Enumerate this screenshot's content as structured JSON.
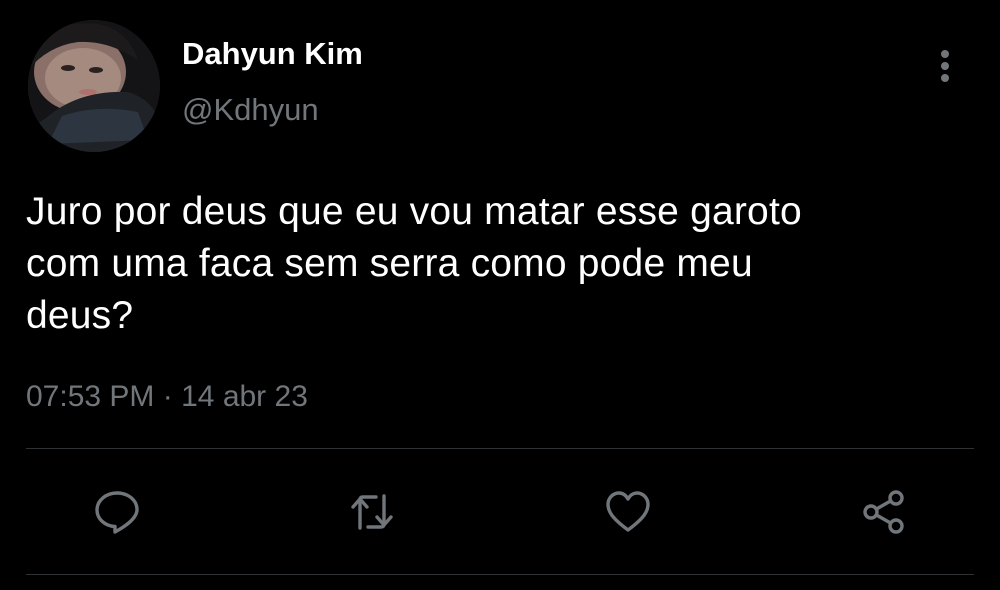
{
  "tweet": {
    "author": {
      "display_name": "Dahyun Kim",
      "handle": "@Kdhyun"
    },
    "text_lines": [
      "Juro por deus que eu vou matar esse garoto",
      "com uma faca sem serra como pode meu",
      "deus?"
    ],
    "time": "07:53 PM",
    "separator": "·",
    "date": "14 abr 23"
  },
  "icons": {
    "more": "more-vertical-icon",
    "reply": "reply-icon",
    "retweet": "retweet-icon",
    "like": "heart-icon",
    "share": "share-icon"
  },
  "colors": {
    "background": "#000000",
    "primary_text": "#ffffff",
    "secondary_text": "#71767b",
    "divider": "#2f3336",
    "icon": "#71767b"
  }
}
